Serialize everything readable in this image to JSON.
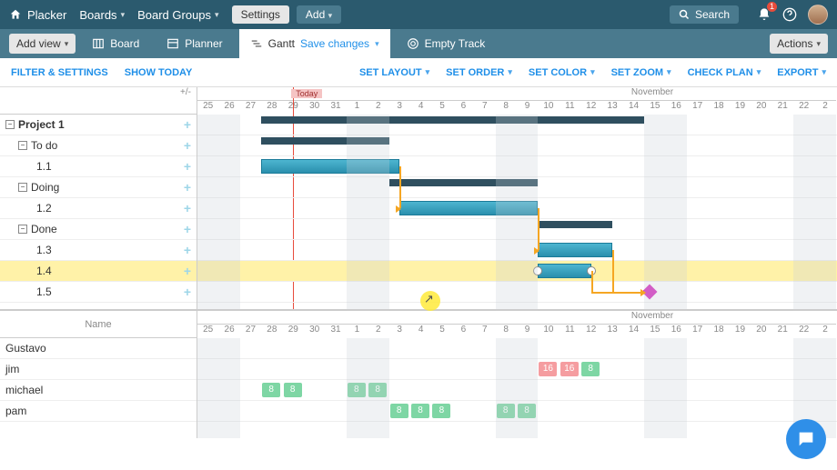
{
  "header": {
    "brand": "Placker",
    "nav": [
      "Boards",
      "Board Groups"
    ],
    "settings": "Settings",
    "add": "Add",
    "search": "Search",
    "notif_count": "1"
  },
  "viewbar": {
    "add_view": "Add view",
    "tabs": {
      "board": "Board",
      "planner": "Planner",
      "gantt": "Gantt",
      "save": "Save changes",
      "empty": "Empty Track"
    },
    "actions": "Actions"
  },
  "optbar": {
    "filter": "FILTER & SETTINGS",
    "today": "SHOW TODAY",
    "layout": "SET LAYOUT",
    "order": "SET ORDER",
    "color": "SET COLOR",
    "zoom": "SET ZOOM",
    "check": "CHECK PLAN",
    "export": "EXPORT"
  },
  "timeline": {
    "month": "November",
    "today": "Today",
    "days": [
      "25",
      "26",
      "27",
      "28",
      "29",
      "30",
      "31",
      "1",
      "2",
      "3",
      "4",
      "5",
      "6",
      "7",
      "8",
      "9",
      "10",
      "11",
      "12",
      "13",
      "14",
      "15",
      "16",
      "17",
      "18",
      "19",
      "20",
      "21",
      "22",
      "2"
    ],
    "head_micro": "+/-"
  },
  "tasks": [
    {
      "label": "Project 1",
      "level": 0,
      "collapsible": true
    },
    {
      "label": "To do",
      "level": 1,
      "collapsible": true
    },
    {
      "label": "1.1",
      "level": 2
    },
    {
      "label": "Doing",
      "level": 1,
      "collapsible": true
    },
    {
      "label": "1.2",
      "level": 2
    },
    {
      "label": "Done",
      "level": 1,
      "collapsible": true
    },
    {
      "label": "1.3",
      "level": 2
    },
    {
      "label": "1.4",
      "level": 2,
      "highlight": true
    },
    {
      "label": "1.5",
      "level": 2
    }
  ],
  "resources": {
    "name_header": "Name",
    "people": [
      "Gustavo",
      "jim",
      "michael",
      "pam"
    ]
  },
  "chart_data": {
    "type": "gantt",
    "unit": "day-index (0 = Oct 25)",
    "summaries": [
      {
        "row": 0,
        "start": 3,
        "end": 21
      },
      {
        "row": 1,
        "start": 3,
        "end": 9
      },
      {
        "row": 3,
        "start": 9,
        "end": 16
      },
      {
        "row": 5,
        "start": 16,
        "end": 19.5
      }
    ],
    "bars": [
      {
        "row": 2,
        "start": 3,
        "end": 9.5
      },
      {
        "row": 4,
        "start": 9.5,
        "end": 16
      },
      {
        "row": 6,
        "start": 16,
        "end": 19.5
      },
      {
        "row": 7,
        "start": 16,
        "end": 18.5
      }
    ],
    "milestones": [
      {
        "row": 8,
        "at": 21
      }
    ],
    "dependencies": [
      {
        "from_row": 2,
        "to_row": 4
      },
      {
        "from_row": 4,
        "to_row": 6
      },
      {
        "from_row": 6,
        "to_row": 8
      },
      {
        "from_row": 7,
        "to_row": 8
      }
    ],
    "today_index": 4.5,
    "weekend_start_indices": [
      0,
      7,
      14,
      21,
      28
    ],
    "resource_allocations": {
      "jim": [
        {
          "day": 16,
          "val": "16",
          "over": true
        },
        {
          "day": 17,
          "val": "16",
          "over": true
        },
        {
          "day": 18,
          "val": "8"
        }
      ],
      "michael": [
        {
          "day": 3,
          "val": "8"
        },
        {
          "day": 4,
          "val": "8"
        },
        {
          "day": 7,
          "val": "8"
        },
        {
          "day": 8,
          "val": "8"
        }
      ],
      "pam": [
        {
          "day": 9,
          "val": "8"
        },
        {
          "day": 10,
          "val": "8"
        },
        {
          "day": 11,
          "val": "8"
        },
        {
          "day": 14,
          "val": "8"
        },
        {
          "day": 15,
          "val": "8"
        }
      ]
    }
  }
}
